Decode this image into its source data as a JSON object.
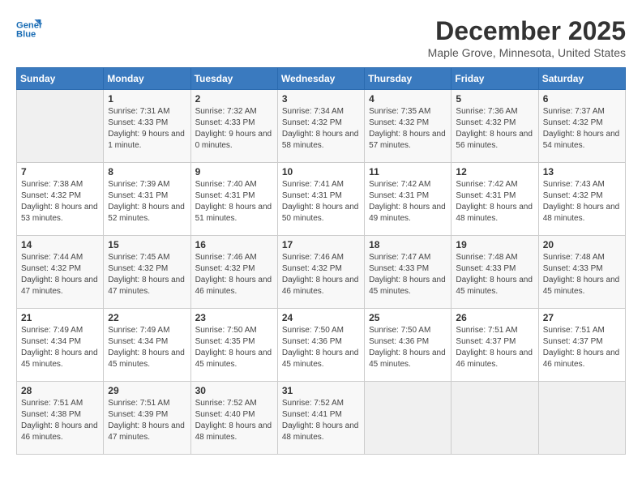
{
  "header": {
    "logo_line1": "General",
    "logo_line2": "Blue",
    "month": "December 2025",
    "location": "Maple Grove, Minnesota, United States"
  },
  "weekdays": [
    "Sunday",
    "Monday",
    "Tuesday",
    "Wednesday",
    "Thursday",
    "Friday",
    "Saturday"
  ],
  "weeks": [
    [
      {
        "day": "",
        "sunrise": "",
        "sunset": "",
        "daylight": ""
      },
      {
        "day": "1",
        "sunrise": "Sunrise: 7:31 AM",
        "sunset": "Sunset: 4:33 PM",
        "daylight": "Daylight: 9 hours and 1 minute."
      },
      {
        "day": "2",
        "sunrise": "Sunrise: 7:32 AM",
        "sunset": "Sunset: 4:33 PM",
        "daylight": "Daylight: 9 hours and 0 minutes."
      },
      {
        "day": "3",
        "sunrise": "Sunrise: 7:34 AM",
        "sunset": "Sunset: 4:32 PM",
        "daylight": "Daylight: 8 hours and 58 minutes."
      },
      {
        "day": "4",
        "sunrise": "Sunrise: 7:35 AM",
        "sunset": "Sunset: 4:32 PM",
        "daylight": "Daylight: 8 hours and 57 minutes."
      },
      {
        "day": "5",
        "sunrise": "Sunrise: 7:36 AM",
        "sunset": "Sunset: 4:32 PM",
        "daylight": "Daylight: 8 hours and 56 minutes."
      },
      {
        "day": "6",
        "sunrise": "Sunrise: 7:37 AM",
        "sunset": "Sunset: 4:32 PM",
        "daylight": "Daylight: 8 hours and 54 minutes."
      }
    ],
    [
      {
        "day": "7",
        "sunrise": "Sunrise: 7:38 AM",
        "sunset": "Sunset: 4:32 PM",
        "daylight": "Daylight: 8 hours and 53 minutes."
      },
      {
        "day": "8",
        "sunrise": "Sunrise: 7:39 AM",
        "sunset": "Sunset: 4:31 PM",
        "daylight": "Daylight: 8 hours and 52 minutes."
      },
      {
        "day": "9",
        "sunrise": "Sunrise: 7:40 AM",
        "sunset": "Sunset: 4:31 PM",
        "daylight": "Daylight: 8 hours and 51 minutes."
      },
      {
        "day": "10",
        "sunrise": "Sunrise: 7:41 AM",
        "sunset": "Sunset: 4:31 PM",
        "daylight": "Daylight: 8 hours and 50 minutes."
      },
      {
        "day": "11",
        "sunrise": "Sunrise: 7:42 AM",
        "sunset": "Sunset: 4:31 PM",
        "daylight": "Daylight: 8 hours and 49 minutes."
      },
      {
        "day": "12",
        "sunrise": "Sunrise: 7:42 AM",
        "sunset": "Sunset: 4:31 PM",
        "daylight": "Daylight: 8 hours and 48 minutes."
      },
      {
        "day": "13",
        "sunrise": "Sunrise: 7:43 AM",
        "sunset": "Sunset: 4:32 PM",
        "daylight": "Daylight: 8 hours and 48 minutes."
      }
    ],
    [
      {
        "day": "14",
        "sunrise": "Sunrise: 7:44 AM",
        "sunset": "Sunset: 4:32 PM",
        "daylight": "Daylight: 8 hours and 47 minutes."
      },
      {
        "day": "15",
        "sunrise": "Sunrise: 7:45 AM",
        "sunset": "Sunset: 4:32 PM",
        "daylight": "Daylight: 8 hours and 47 minutes."
      },
      {
        "day": "16",
        "sunrise": "Sunrise: 7:46 AM",
        "sunset": "Sunset: 4:32 PM",
        "daylight": "Daylight: 8 hours and 46 minutes."
      },
      {
        "day": "17",
        "sunrise": "Sunrise: 7:46 AM",
        "sunset": "Sunset: 4:32 PM",
        "daylight": "Daylight: 8 hours and 46 minutes."
      },
      {
        "day": "18",
        "sunrise": "Sunrise: 7:47 AM",
        "sunset": "Sunset: 4:33 PM",
        "daylight": "Daylight: 8 hours and 45 minutes."
      },
      {
        "day": "19",
        "sunrise": "Sunrise: 7:48 AM",
        "sunset": "Sunset: 4:33 PM",
        "daylight": "Daylight: 8 hours and 45 minutes."
      },
      {
        "day": "20",
        "sunrise": "Sunrise: 7:48 AM",
        "sunset": "Sunset: 4:33 PM",
        "daylight": "Daylight: 8 hours and 45 minutes."
      }
    ],
    [
      {
        "day": "21",
        "sunrise": "Sunrise: 7:49 AM",
        "sunset": "Sunset: 4:34 PM",
        "daylight": "Daylight: 8 hours and 45 minutes."
      },
      {
        "day": "22",
        "sunrise": "Sunrise: 7:49 AM",
        "sunset": "Sunset: 4:34 PM",
        "daylight": "Daylight: 8 hours and 45 minutes."
      },
      {
        "day": "23",
        "sunrise": "Sunrise: 7:50 AM",
        "sunset": "Sunset: 4:35 PM",
        "daylight": "Daylight: 8 hours and 45 minutes."
      },
      {
        "day": "24",
        "sunrise": "Sunrise: 7:50 AM",
        "sunset": "Sunset: 4:36 PM",
        "daylight": "Daylight: 8 hours and 45 minutes."
      },
      {
        "day": "25",
        "sunrise": "Sunrise: 7:50 AM",
        "sunset": "Sunset: 4:36 PM",
        "daylight": "Daylight: 8 hours and 45 minutes."
      },
      {
        "day": "26",
        "sunrise": "Sunrise: 7:51 AM",
        "sunset": "Sunset: 4:37 PM",
        "daylight": "Daylight: 8 hours and 46 minutes."
      },
      {
        "day": "27",
        "sunrise": "Sunrise: 7:51 AM",
        "sunset": "Sunset: 4:37 PM",
        "daylight": "Daylight: 8 hours and 46 minutes."
      }
    ],
    [
      {
        "day": "28",
        "sunrise": "Sunrise: 7:51 AM",
        "sunset": "Sunset: 4:38 PM",
        "daylight": "Daylight: 8 hours and 46 minutes."
      },
      {
        "day": "29",
        "sunrise": "Sunrise: 7:51 AM",
        "sunset": "Sunset: 4:39 PM",
        "daylight": "Daylight: 8 hours and 47 minutes."
      },
      {
        "day": "30",
        "sunrise": "Sunrise: 7:52 AM",
        "sunset": "Sunset: 4:40 PM",
        "daylight": "Daylight: 8 hours and 48 minutes."
      },
      {
        "day": "31",
        "sunrise": "Sunrise: 7:52 AM",
        "sunset": "Sunset: 4:41 PM",
        "daylight": "Daylight: 8 hours and 48 minutes."
      },
      {
        "day": "",
        "sunrise": "",
        "sunset": "",
        "daylight": ""
      },
      {
        "day": "",
        "sunrise": "",
        "sunset": "",
        "daylight": ""
      },
      {
        "day": "",
        "sunrise": "",
        "sunset": "",
        "daylight": ""
      }
    ]
  ]
}
